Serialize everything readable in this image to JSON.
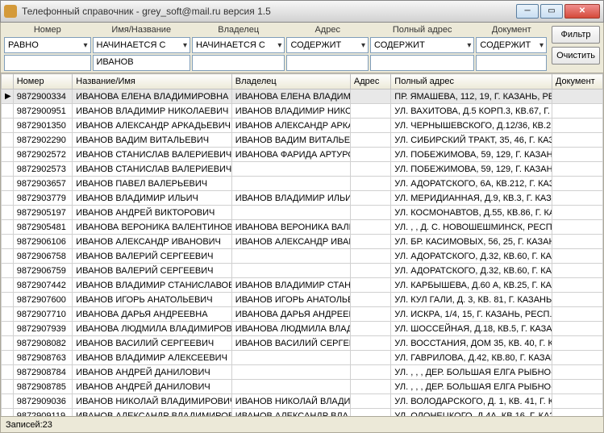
{
  "window": {
    "title": "Телефонный справочник  - grey_soft@mail.ru версия 1.5"
  },
  "filters": {
    "columns": [
      {
        "label": "Номер",
        "op": "РАВНО",
        "value": ""
      },
      {
        "label": "Имя/Название",
        "op": "НАЧИНАЕТСЯ С",
        "value": "ИВАНОВ"
      },
      {
        "label": "Владелец",
        "op": "НАЧИНАЕТСЯ С",
        "value": ""
      },
      {
        "label": "Адрес",
        "op": "СОДЕРЖИТ",
        "value": ""
      },
      {
        "label": "Полный адрес",
        "op": "СОДЕРЖИТ",
        "value": ""
      },
      {
        "label": "Документ",
        "op": "СОДЕРЖИТ",
        "value": ""
      }
    ],
    "filter_btn": "Фильтр",
    "clear_btn": "Очистить"
  },
  "grid": {
    "headers": [
      "Номер",
      "Название/Имя",
      "Владелец",
      "Адрес",
      "Полный адрес",
      "Документ"
    ],
    "rows": [
      {
        "num": "9872900334",
        "name": "ИВАНОВА ЕЛЕНА ВЛАДИМИРОВНА",
        "owner": "ИВАНОВА ЕЛЕНА ВЛАДИМИР",
        "addr": "",
        "full": "ПР. ЯМАШЕВА, 112, 19, Г. КАЗАНЬ, РЕС",
        "doc": ""
      },
      {
        "num": "9872900951",
        "name": "ИВАНОВ ВЛАДИМИР НИКОЛАЕВИЧ",
        "owner": "ИВАНОВ ВЛАДИМИР НИКОЛА",
        "addr": "",
        "full": "УЛ. ВАХИТОВА, Д.5 КОРП.3, КВ.67, Г. К",
        "doc": ""
      },
      {
        "num": "9872901350",
        "name": "ИВАНОВ АЛЕКСАНДР АРКАДЬЕВИЧ",
        "owner": "ИВАНОВ АЛЕКСАНДР АРКАДІ",
        "addr": "",
        "full": "УЛ. ЧЕРНЫШЕВСКОГО, Д.12/36, КВ.21,",
        "doc": ""
      },
      {
        "num": "9872902290",
        "name": "ИВАНОВ ВАДИМ ВИТАЛЬЕВИЧ",
        "owner": "ИВАНОВ ВАДИМ ВИТАЛЬЕВИ",
        "addr": "",
        "full": "УЛ. СИБИРСКИЙ ТРАКТ, 35, 46, Г. КАЗА",
        "doc": ""
      },
      {
        "num": "9872902572",
        "name": "ИВАНОВ СТАНИСЛАВ ВАЛЕРИЕВИЧ",
        "owner": "ИВАНОВА ФАРИДА АРТУРОВ",
        "addr": "",
        "full": "УЛ. ПОБЕЖИМОВА, 59, 129, Г. КАЗАНЬ,",
        "doc": ""
      },
      {
        "num": "9872902573",
        "name": "ИВАНОВ СТАНИСЛАВ ВАЛЕРИЕВИЧ",
        "owner": "",
        "addr": "",
        "full": "УЛ. ПОБЕЖИМОВА, 59, 129, Г. КАЗАНЬ,",
        "doc": ""
      },
      {
        "num": "9872903657",
        "name": "ИВАНОВ ПАВЕЛ ВАЛЕРЬЕВИЧ",
        "owner": "",
        "addr": "",
        "full": "УЛ. АДОРАТСКОГО, 6А, КВ.212, Г. КАЗ",
        "doc": ""
      },
      {
        "num": "9872903779",
        "name": "ИВАНОВ ВЛАДИМИР ИЛЬИЧ",
        "owner": "ИВАНОВ ВЛАДИМИР ИЛЬИЧ",
        "addr": "",
        "full": "УЛ. МЕРИДИАННАЯ, Д.9, КВ.3, Г. КАЗАН",
        "doc": ""
      },
      {
        "num": "9872905197",
        "name": "ИВАНОВ АНДРЕЙ ВИКТОРОВИЧ",
        "owner": "",
        "addr": "",
        "full": "УЛ. КОСМОНАВТОВ, Д.55, КВ.86, Г. КА",
        "doc": ""
      },
      {
        "num": "9872905481",
        "name": "ИВАНОВА ВЕРОНИКА ВАЛЕНТИНОВНА",
        "owner": "ИВАНОВА ВЕРОНИКА ВАЛЕНТ",
        "addr": "",
        "full": "УЛ. , , Д. С. НОВОШЕШМИНСК, РЕСП. ТА",
        "doc": ""
      },
      {
        "num": "9872906106",
        "name": "ИВАНОВ АЛЕКСАНДР ИВАНОВИЧ",
        "owner": "ИВАНОВ АЛЕКСАНДР ИВАНОВ",
        "addr": "",
        "full": "УЛ. БР. КАСИМОВЫХ, 56, 25, Г. КАЗАНЬ",
        "doc": ""
      },
      {
        "num": "9872906758",
        "name": "ИВАНОВ ВАЛЕРИЙ СЕРГЕЕВИЧ",
        "owner": "",
        "addr": "",
        "full": "УЛ. АДОРАТСКОГО, Д.32, КВ.60, Г. КАЗ",
        "doc": ""
      },
      {
        "num": "9872906759",
        "name": "ИВАНОВ ВАЛЕРИЙ СЕРГЕЕВИЧ",
        "owner": "",
        "addr": "",
        "full": "УЛ. АДОРАТСКОГО, Д.32, КВ.60, Г. КАЗ",
        "doc": ""
      },
      {
        "num": "9872907442",
        "name": "ИВАНОВ ВЛАДИМИР СТАНИСЛАВОВИЧ",
        "owner": "ИВАНОВ ВЛАДИМИР СТАНИС",
        "addr": "",
        "full": "УЛ. КАРБЫШЕВА, Д.60 А, КВ.25, Г. КАЗ",
        "doc": ""
      },
      {
        "num": "9872907600",
        "name": "ИВАНОВ ИГОРЬ АНАТОЛЬЕВИЧ",
        "owner": "ИВАНОВ ИГОРЬ АНАТОЛЬЕВІ",
        "addr": "",
        "full": "УЛ. КУЛ ГАЛИ, Д. 3, КВ. 81, Г. КАЗАНЬ,",
        "doc": ""
      },
      {
        "num": "9872907710",
        "name": "ИВАНОВА ДАРЬЯ АНДРЕЕВНА",
        "owner": "ИВАНОВА ДАРЬЯ АНДРЕЕВН",
        "addr": "",
        "full": "УЛ. ИСКРА, 1/4, 15, Г. КАЗАНЬ, РЕСП. Т",
        "doc": ""
      },
      {
        "num": "9872907939",
        "name": "ИВАНОВА ЛЮДМИЛА ВЛАДИМИРОВНА",
        "owner": "ИВАНОВА ЛЮДМИЛА ВЛАДИ",
        "addr": "",
        "full": "УЛ. ШОССЕЙНАЯ, Д.18, КВ.5, Г. КАЗАН",
        "doc": ""
      },
      {
        "num": "9872908082",
        "name": "ИВАНОВ ВАСИЛИЙ СЕРГЕЕВИЧ",
        "owner": "ИВАНОВ ВАСИЛИЙ СЕРГЕЕВІ",
        "addr": "",
        "full": "УЛ. ВОССТАНИЯ, ДОМ 35, КВ. 40, Г. КА",
        "doc": ""
      },
      {
        "num": "9872908763",
        "name": "ИВАНОВ ВЛАДИМИР АЛЕКСЕЕВИЧ",
        "owner": "",
        "addr": "",
        "full": "УЛ. ГАВРИЛОВА, Д.42, КВ.80, Г. КАЗАН",
        "doc": ""
      },
      {
        "num": "9872908784",
        "name": "ИВАНОВ АНДРЕЙ ДАНИЛОВИЧ",
        "owner": "",
        "addr": "",
        "full": "УЛ. , , , ДЕР. БОЛЬШАЯ ЕЛГА РЫБНО-С",
        "doc": ""
      },
      {
        "num": "9872908785",
        "name": "ИВАНОВ АНДРЕЙ ДАНИЛОВИЧ",
        "owner": "",
        "addr": "",
        "full": "УЛ. , , , ДЕР. БОЛЬШАЯ ЕЛГА РЫБНО-С",
        "doc": ""
      },
      {
        "num": "9872909036",
        "name": "ИВАНОВ НИКОЛАЙ ВЛАДИМИРОВИЧ",
        "owner": "ИВАНОВ НИКОЛАЙ ВЛАДИМІ",
        "addr": "",
        "full": "УЛ. ВОЛОДАРСКОГО, Д. 1, КВ. 41, Г. КА",
        "doc": ""
      },
      {
        "num": "9872909119",
        "name": "ИВАНОВ АЛЕКСАНДР ВЛАДИМИРОВИЧ",
        "owner": "ИВАНОВ АЛЕКСАНДР ВЛАДИ",
        "addr": "",
        "full": "УЛ. ОЛОНЕЦКОГО, Д.4А, КВ.16, Г. КАЗ",
        "doc": ""
      }
    ]
  },
  "status": {
    "records_label": "Записей:23"
  }
}
